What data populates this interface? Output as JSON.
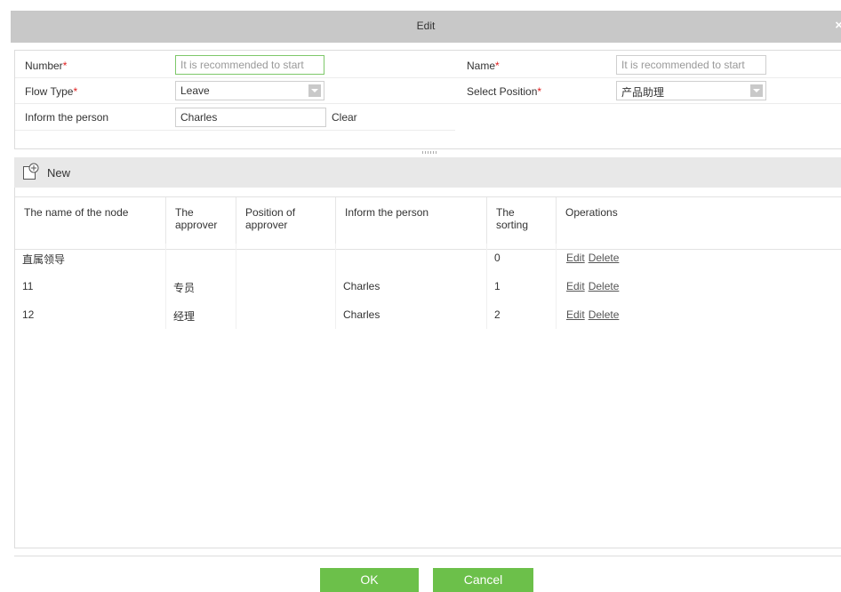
{
  "dialog": {
    "title": "Edit",
    "close_symbol": "×"
  },
  "form": {
    "number_label": "Number",
    "number_placeholder": "It is recommended to start",
    "name_label": "Name",
    "name_placeholder": "It is recommended to start",
    "flow_type_label": "Flow Type",
    "flow_type_value": "Leave",
    "select_position_label": "Select Position",
    "select_position_value": "产品助理",
    "inform_label": "Inform the person",
    "inform_value": "Charles",
    "clear_label": "Clear",
    "required_mark": "*"
  },
  "toolbar": {
    "new_label": "New"
  },
  "table": {
    "columns": [
      "The name of the node",
      "The approver",
      "Position of approver",
      "Inform the person",
      "The sorting",
      "Operations"
    ],
    "rows": [
      {
        "node": "直属领导",
        "approver": "",
        "position": "",
        "inform": "",
        "sorting": "0"
      },
      {
        "node": "11",
        "approver": "专员",
        "position": "",
        "inform": "Charles",
        "sorting": "1"
      },
      {
        "node": "12",
        "approver": "经理",
        "position": "",
        "inform": "Charles",
        "sorting": "2"
      }
    ],
    "edit_label": "Edit",
    "delete_label": "Delete"
  },
  "footer": {
    "ok_label": "OK",
    "cancel_label": "Cancel"
  },
  "colors": {
    "accent_green": "#6cc04a",
    "titlebar": "#c8c8c8",
    "required": "#e02020"
  }
}
